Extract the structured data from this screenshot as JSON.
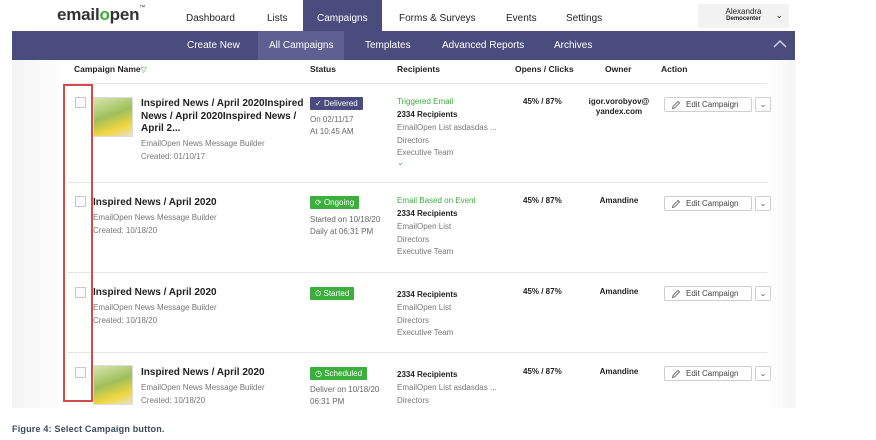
{
  "app": {
    "logo_prefix": "email",
    "logo_o": "o",
    "logo_suffix": "pen",
    "logo_tm": "™"
  },
  "top_nav": {
    "items": [
      "Dashboard",
      "Lists",
      "Campaigns",
      "Forms & Surveys",
      "Events",
      "Settings"
    ],
    "active": "Campaigns"
  },
  "user": {
    "name": "Alexandra",
    "org": "Democenter",
    "caret": "⌄"
  },
  "sub_nav": {
    "items": [
      "Create New",
      "All Campaigns",
      "Templates",
      "Advanced Reports",
      "Archives"
    ],
    "active": "All Campaigns"
  },
  "table": {
    "columns": [
      "Campaign Name",
      "Status",
      "Recipients",
      "Opens / Clicks",
      "Owner",
      "Action"
    ],
    "filter_icon": "▽",
    "rows": [
      {
        "title_lines": [
          "Inspired News / April 2020Inspired",
          "News / April 2020Inspired News /",
          "April 2..."
        ],
        "builder": "EmailOpen News Message Builder",
        "created": "Created: 01/10/17",
        "has_thumb": true,
        "status": "Delivered",
        "status_icon": "✓",
        "status_meta": [
          "On 02/11/17",
          "At 10:45 AM"
        ],
        "rec_type": "Triggered Email",
        "rec_count": "2334 Recipients",
        "rec_lists": [
          "EmailOpen List asdasdas ...",
          "Directors",
          "Executive Team"
        ],
        "rec_more": "⌄",
        "opens_clicks": "45% / 87%",
        "owner": "igor.vorobyov@yandex.com",
        "action": "Edit Campaign",
        "action_caret": "⌄"
      },
      {
        "title_lines": [
          "Inspired News / April 2020"
        ],
        "builder": "EmailOpen News Message Builder",
        "created": "Created: 10/18/20",
        "has_thumb": false,
        "status": "Ongoing",
        "status_icon": "⟳",
        "status_meta": [
          "Started on 10/18/20",
          "Daily at 06:31 PM"
        ],
        "rec_type": "Email Based on Event",
        "rec_count": "2334 Recipients",
        "rec_lists": [
          "EmailOpen List",
          "Directors",
          "Executive Team"
        ],
        "opens_clicks": "45% / 87%",
        "owner": "Amandine",
        "action": "Edit Campaign",
        "action_caret": "⌄"
      },
      {
        "title_lines": [
          "Inspired News / April 2020"
        ],
        "builder": "EmailOpen News Message Builder",
        "created": "Created: 10/18/20",
        "has_thumb": false,
        "status": "Started",
        "status_icon": "⏱",
        "status_meta": [],
        "rec_type": "",
        "rec_count": "2334 Recipients",
        "rec_lists": [
          "EmailOpen List",
          "Directors",
          "Executive Team"
        ],
        "opens_clicks": "45% / 87%",
        "owner": "Amandine",
        "action": "Edit Campaign",
        "action_caret": "⌄"
      },
      {
        "title_lines": [
          "Inspired News / April 2020"
        ],
        "builder": "EmailOpen News Message Builder",
        "created": "Created: 10/18/20",
        "has_thumb": true,
        "status": "Scheduled",
        "status_icon": "◷",
        "status_meta": [
          "Deliver on 10/18/20",
          "06:31 PM"
        ],
        "rec_type": "",
        "rec_count": "2334 Recipients",
        "rec_lists": [
          "EmailOpen List asdasdas ...",
          "Directors"
        ],
        "opens_clicks": "45% / 87%",
        "owner": "Amandine",
        "action": "Edit Campaign",
        "action_caret": "⌄"
      }
    ]
  },
  "caption": "Figure 4: Select Campaign button.",
  "colors": {
    "primary": "#4b4c7e",
    "accent_green": "#3cae3c",
    "highlight_red": "#d24b4b"
  }
}
